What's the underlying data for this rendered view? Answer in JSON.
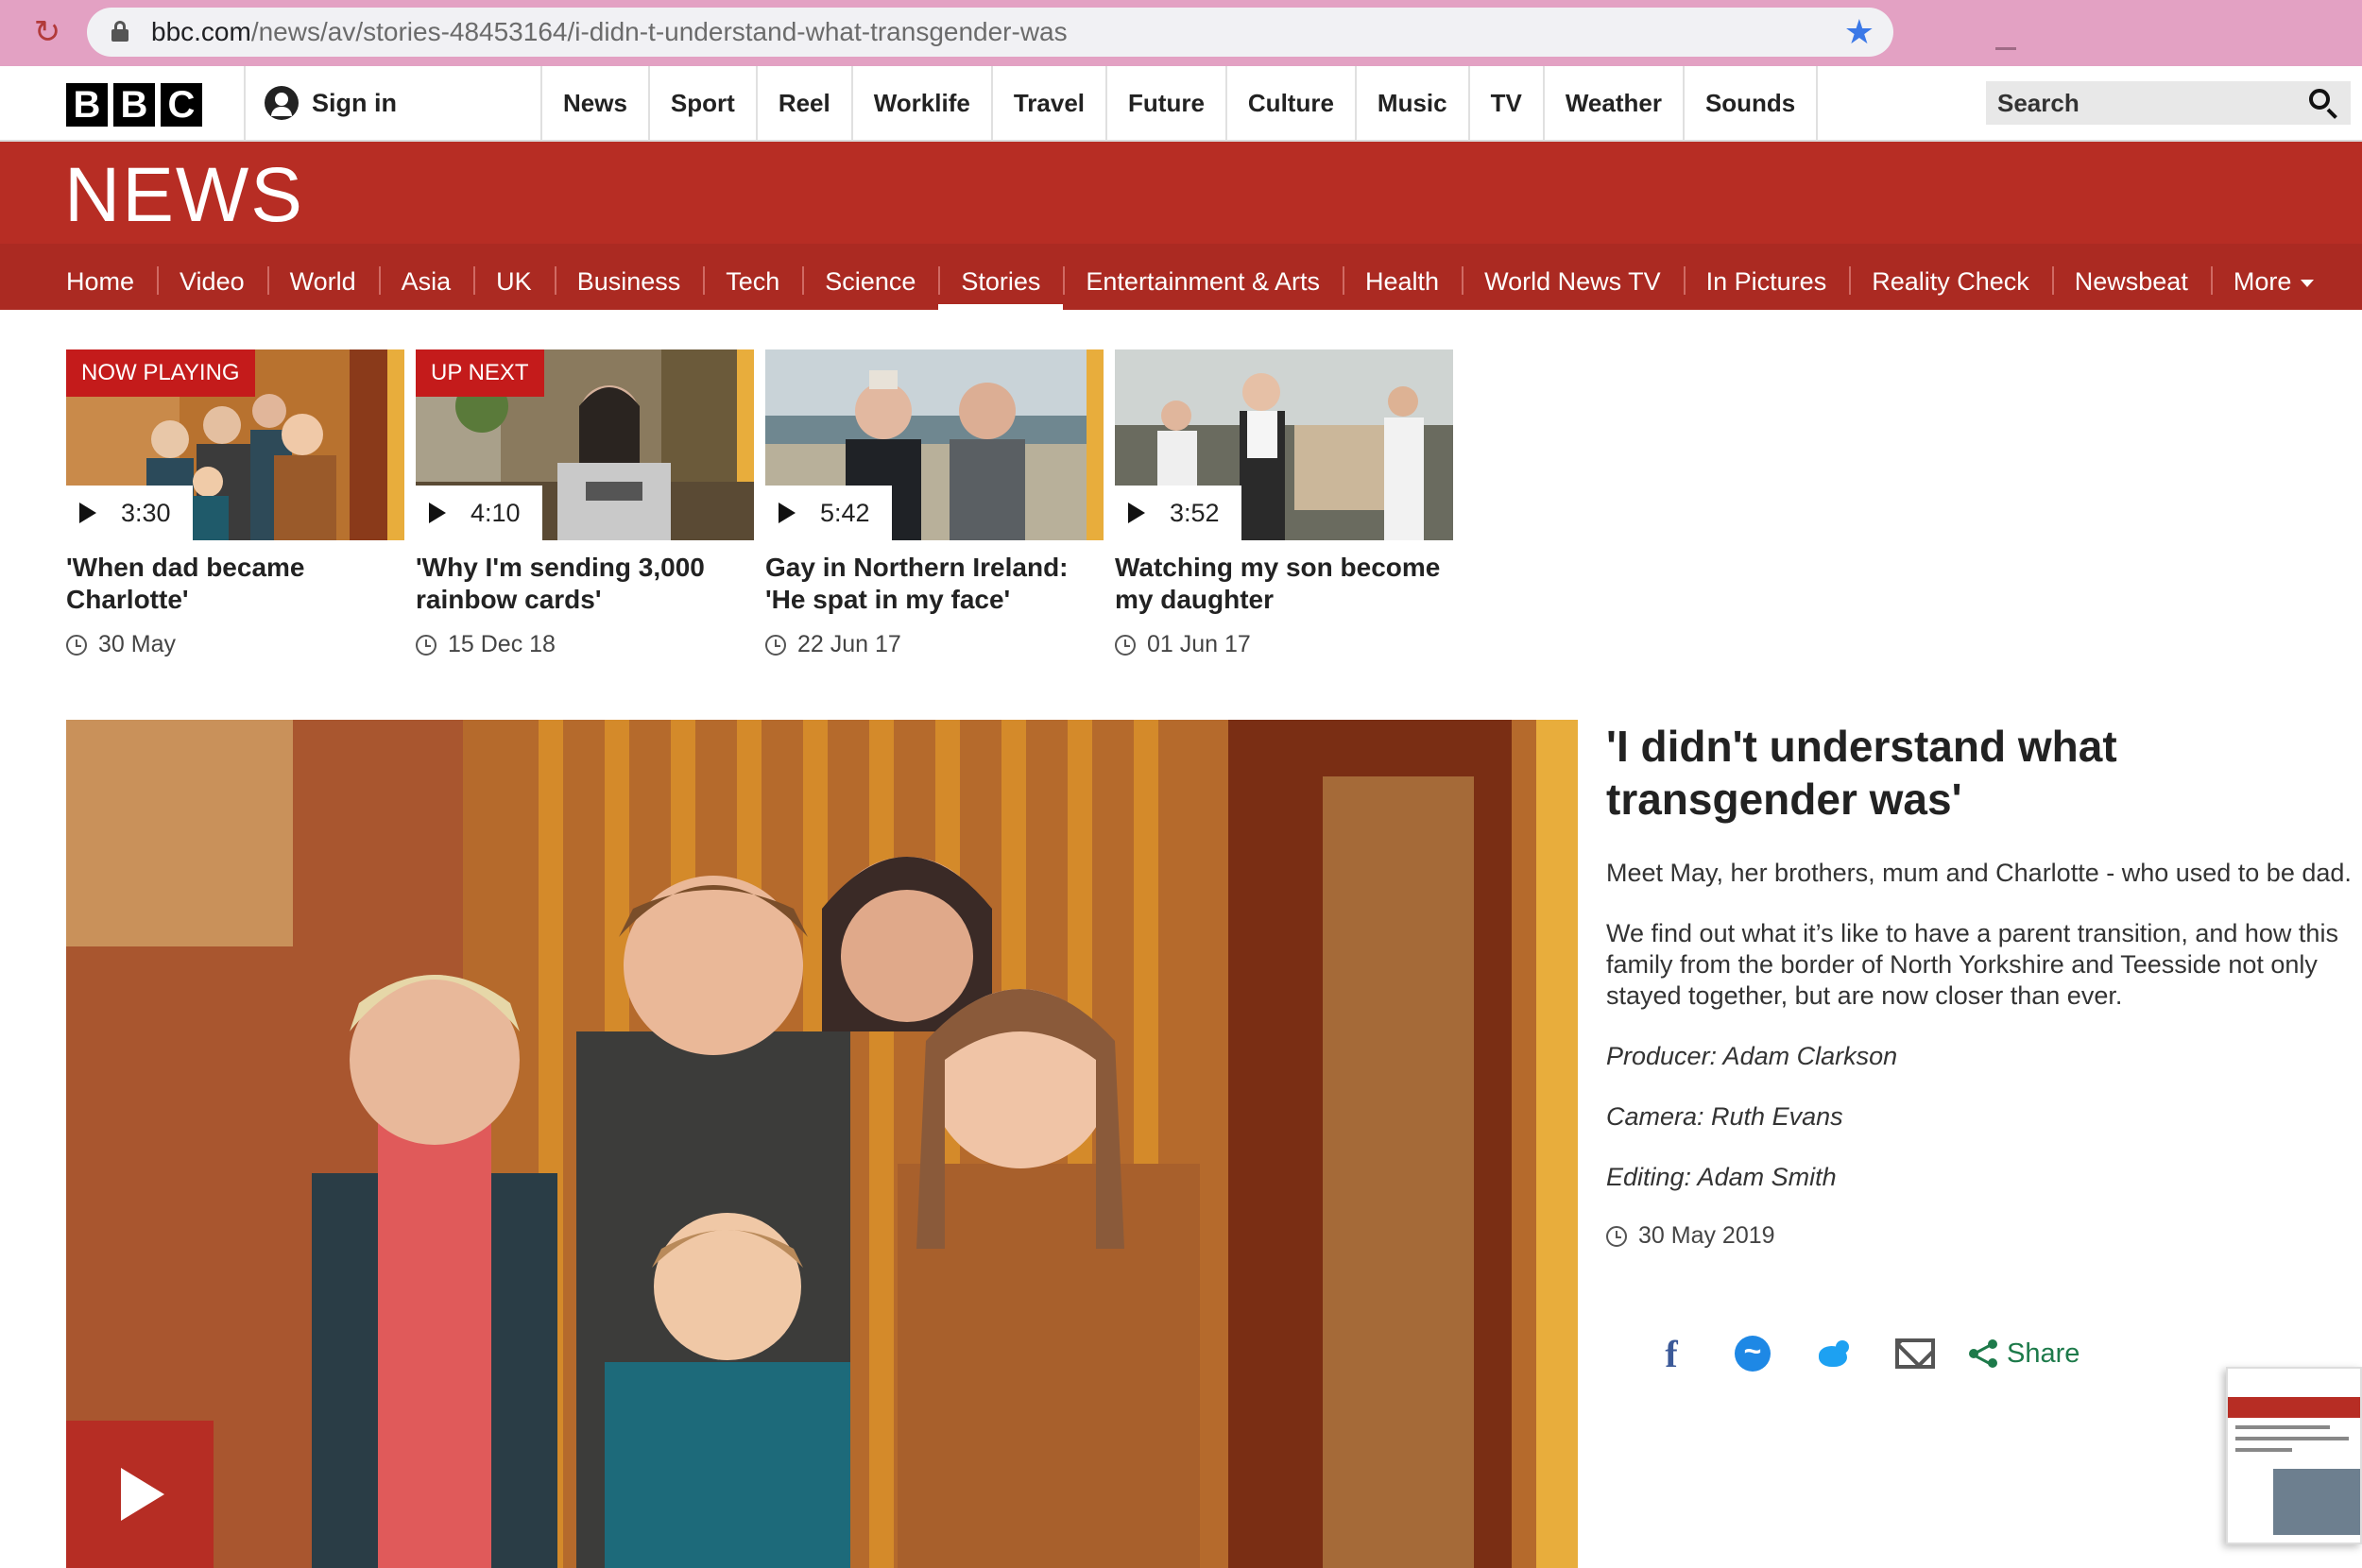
{
  "browser": {
    "url_host": "bbc.com",
    "url_path": "/news/av/stories-48453164/i-didn-t-understand-what-transgender-was"
  },
  "header": {
    "logo": [
      "B",
      "B",
      "C"
    ],
    "sign_in": "Sign in",
    "nav": [
      "News",
      "Sport",
      "Reel",
      "Worklife",
      "Travel",
      "Future",
      "Culture",
      "Music",
      "TV",
      "Weather",
      "Sounds"
    ],
    "search_label": "Search"
  },
  "news": {
    "title": "NEWS",
    "sections": [
      "Home",
      "Video",
      "World",
      "Asia",
      "UK",
      "Business",
      "Tech",
      "Science",
      "Stories",
      "Entertainment & Arts",
      "Health",
      "World News TV",
      "In Pictures",
      "Reality Check",
      "Newsbeat",
      "More"
    ],
    "active_section": "Stories"
  },
  "playlist": [
    {
      "badge": "NOW PLAYING",
      "duration": "3:30",
      "title": "'When dad became Charlotte'",
      "date": "30 May"
    },
    {
      "badge": "UP NEXT",
      "duration": "4:10",
      "title": "'Why I'm sending 3,000 rainbow cards'",
      "date": "15 Dec 18"
    },
    {
      "badge": "",
      "duration": "5:42",
      "title": "Gay in Northern Ireland: 'He spat in my face'",
      "date": "22 Jun 17"
    },
    {
      "badge": "",
      "duration": "3:52",
      "title": "Watching my son become my daughter",
      "date": "01 Jun 17"
    }
  ],
  "story": {
    "headline": "'I didn't understand what transgender was'",
    "summary": "Meet May, her brothers, mum and Charlotte - who used to be dad.",
    "body": "We find out what it’s like to have a parent transition, and how this family from the border of North Yorkshire and Teesside not only stayed together, but are now closer than ever.",
    "producer": "Producer: Adam Clarkson",
    "camera": "Camera: Ruth Evans",
    "editing": "Editing: Adam Smith",
    "date": "30 May 2019",
    "share_label": "Share"
  },
  "colors": {
    "bbc_red": "#b72d24",
    "nav_red": "#ab2a22",
    "badge_red": "#c41b1b",
    "share_green": "#1d7a4a",
    "chrome_pink": "#e3a1c3"
  }
}
